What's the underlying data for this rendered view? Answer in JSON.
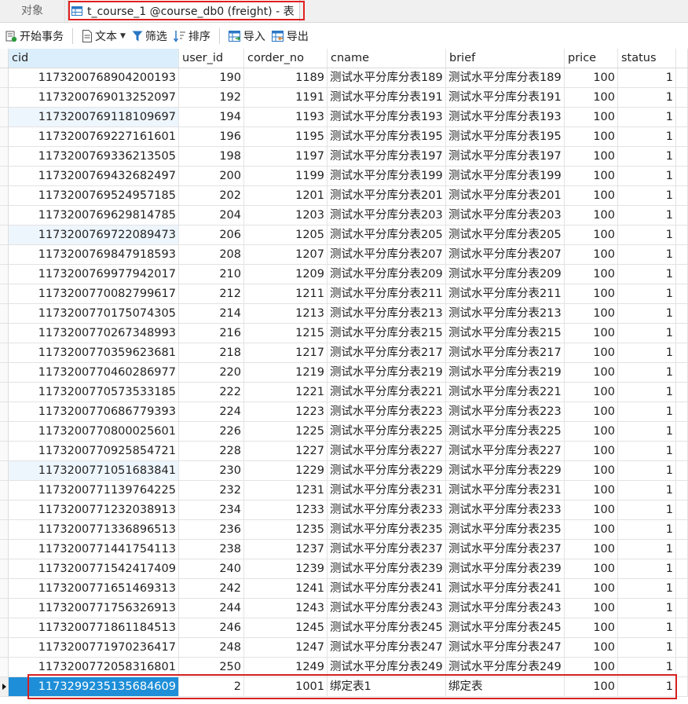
{
  "tabs": {
    "objects_label": "对象",
    "active_label": "t_course_1 @course_db0 (freight) - 表"
  },
  "toolbar": {
    "begin_tx": "开始事务",
    "text": "文本",
    "filter": "筛选",
    "sort": "排序",
    "import": "导入",
    "export": "导出"
  },
  "columns": [
    "cid",
    "user_id",
    "corder_no",
    "cname",
    "brief",
    "price",
    "status"
  ],
  "rows": [
    [
      "1173200768904200193",
      "190",
      "1189",
      "测试水平分库分表189",
      "测试水平分库分表189",
      "100",
      "1"
    ],
    [
      "1173200769013252097",
      "192",
      "1191",
      "测试水平分库分表191",
      "测试水平分库分表191",
      "100",
      "1"
    ],
    [
      "1173200769118109697",
      "194",
      "1193",
      "测试水平分库分表193",
      "测试水平分库分表193",
      "100",
      "1"
    ],
    [
      "1173200769227161601",
      "196",
      "1195",
      "测试水平分库分表195",
      "测试水平分库分表195",
      "100",
      "1"
    ],
    [
      "1173200769336213505",
      "198",
      "1197",
      "测试水平分库分表197",
      "测试水平分库分表197",
      "100",
      "1"
    ],
    [
      "1173200769432682497",
      "200",
      "1199",
      "测试水平分库分表199",
      "测试水平分库分表199",
      "100",
      "1"
    ],
    [
      "1173200769524957185",
      "202",
      "1201",
      "测试水平分库分表201",
      "测试水平分库分表201",
      "100",
      "1"
    ],
    [
      "1173200769629814785",
      "204",
      "1203",
      "测试水平分库分表203",
      "测试水平分库分表203",
      "100",
      "1"
    ],
    [
      "1173200769722089473",
      "206",
      "1205",
      "测试水平分库分表205",
      "测试水平分库分表205",
      "100",
      "1"
    ],
    [
      "1173200769847918593",
      "208",
      "1207",
      "测试水平分库分表207",
      "测试水平分库分表207",
      "100",
      "1"
    ],
    [
      "1173200769977942017",
      "210",
      "1209",
      "测试水平分库分表209",
      "测试水平分库分表209",
      "100",
      "1"
    ],
    [
      "1173200770082799617",
      "212",
      "1211",
      "测试水平分库分表211",
      "测试水平分库分表211",
      "100",
      "1"
    ],
    [
      "1173200770175074305",
      "214",
      "1213",
      "测试水平分库分表213",
      "测试水平分库分表213",
      "100",
      "1"
    ],
    [
      "1173200770267348993",
      "216",
      "1215",
      "测试水平分库分表215",
      "测试水平分库分表215",
      "100",
      "1"
    ],
    [
      "1173200770359623681",
      "218",
      "1217",
      "测试水平分库分表217",
      "测试水平分库分表217",
      "100",
      "1"
    ],
    [
      "1173200770460286977",
      "220",
      "1219",
      "测试水平分库分表219",
      "测试水平分库分表219",
      "100",
      "1"
    ],
    [
      "1173200770573533185",
      "222",
      "1221",
      "测试水平分库分表221",
      "测试水平分库分表221",
      "100",
      "1"
    ],
    [
      "1173200770686779393",
      "224",
      "1223",
      "测试水平分库分表223",
      "测试水平分库分表223",
      "100",
      "1"
    ],
    [
      "1173200770800025601",
      "226",
      "1225",
      "测试水平分库分表225",
      "测试水平分库分表225",
      "100",
      "1"
    ],
    [
      "1173200770925854721",
      "228",
      "1227",
      "测试水平分库分表227",
      "测试水平分库分表227",
      "100",
      "1"
    ],
    [
      "1173200771051683841",
      "230",
      "1229",
      "测试水平分库分表229",
      "测试水平分库分表229",
      "100",
      "1"
    ],
    [
      "1173200771139764225",
      "232",
      "1231",
      "测试水平分库分表231",
      "测试水平分库分表231",
      "100",
      "1"
    ],
    [
      "1173200771232038913",
      "234",
      "1233",
      "测试水平分库分表233",
      "测试水平分库分表233",
      "100",
      "1"
    ],
    [
      "1173200771336896513",
      "236",
      "1235",
      "测试水平分库分表235",
      "测试水平分库分表235",
      "100",
      "1"
    ],
    [
      "1173200771441754113",
      "238",
      "1237",
      "测试水平分库分表237",
      "测试水平分库分表237",
      "100",
      "1"
    ],
    [
      "1173200771542417409",
      "240",
      "1239",
      "测试水平分库分表239",
      "测试水平分库分表239",
      "100",
      "1"
    ],
    [
      "1173200771651469313",
      "242",
      "1241",
      "测试水平分库分表241",
      "测试水平分库分表241",
      "100",
      "1"
    ],
    [
      "1173200771756326913",
      "244",
      "1243",
      "测试水平分库分表243",
      "测试水平分库分表243",
      "100",
      "1"
    ],
    [
      "1173200771861184513",
      "246",
      "1245",
      "测试水平分库分表245",
      "测试水平分库分表245",
      "100",
      "1"
    ],
    [
      "1173200771970236417",
      "248",
      "1247",
      "测试水平分库分表247",
      "测试水平分库分表247",
      "100",
      "1"
    ],
    [
      "1173200772058316801",
      "250",
      "1249",
      "测试水平分库分表249",
      "测试水平分库分表249",
      "100",
      "1"
    ],
    [
      "1173299235135684609",
      "2",
      "1001",
      "绑定表1",
      "绑定表",
      "100",
      "1"
    ]
  ],
  "selected_row_index": 31,
  "tinted_rows": [
    2,
    8,
    20
  ],
  "colors": {
    "highlight_border": "#e02020",
    "selection": "#1e8ed8",
    "cid_header_bg": "#dbeefb",
    "icon_blue": "#2b78c5"
  }
}
